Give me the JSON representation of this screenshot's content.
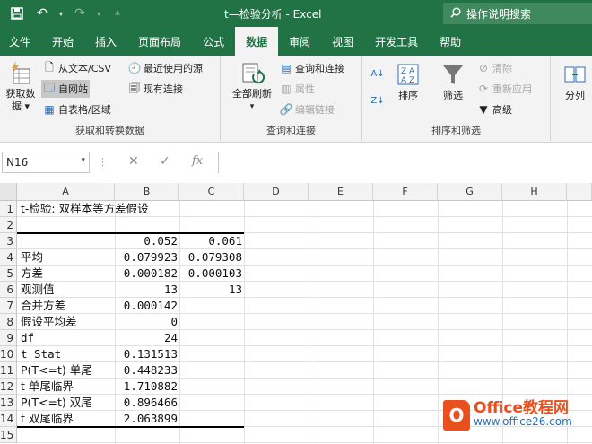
{
  "window": {
    "title": "t—检验分析  -  Excel",
    "tell_me": "操作说明搜索"
  },
  "tabs": [
    {
      "label": "文件"
    },
    {
      "label": "开始"
    },
    {
      "label": "插入"
    },
    {
      "label": "页面布局"
    },
    {
      "label": "公式"
    },
    {
      "label": "数据"
    },
    {
      "label": "审阅"
    },
    {
      "label": "视图"
    },
    {
      "label": "开发工具"
    },
    {
      "label": "帮助"
    }
  ],
  "active_tab": "数据",
  "ribbon": {
    "get_transform": {
      "label": "获取和转换数据",
      "get_data_line1": "获取数",
      "get_data_line2": "据",
      "from_text_csv": "从文本/CSV",
      "from_web": "自网站",
      "from_table": "自表格/区域",
      "recent_sources": "最近使用的源",
      "existing_connections": "现有连接"
    },
    "queries": {
      "label": "查询和连接",
      "refresh_all": "全部刷新",
      "queries_connections": "查询和连接",
      "properties": "属性",
      "edit_links": "编辑链接"
    },
    "sort_filter": {
      "label": "排序和筛选",
      "sort": "排序",
      "filter": "筛选",
      "clear": "清除",
      "reapply": "重新应用",
      "advanced": "高级"
    },
    "data_tools": {
      "split": "分列"
    }
  },
  "formula_bar": {
    "name_box": "N16",
    "fx": "fx",
    "formula": ""
  },
  "columns": [
    "A",
    "B",
    "C",
    "D",
    "E",
    "F",
    "G",
    "H"
  ],
  "rows": [
    "1",
    "2",
    "3",
    "4",
    "5",
    "6",
    "7",
    "8",
    "9",
    "10",
    "11",
    "12",
    "13",
    "14",
    "15"
  ],
  "sheet": {
    "title": "t-检验: 双样本等方差假设",
    "header_b": "0.052",
    "header_c": "0.061",
    "stats": [
      {
        "label": "平均",
        "b": "0.079923",
        "c": "0.079308"
      },
      {
        "label": "方差",
        "b": "0.000182",
        "c": "0.000103"
      },
      {
        "label": "观测值",
        "b": "13",
        "c": "13"
      },
      {
        "label": "合并方差",
        "b": "0.000142",
        "c": ""
      },
      {
        "label": "假设平均差",
        "b": "0",
        "c": ""
      },
      {
        "label": "df",
        "b": "24",
        "c": ""
      },
      {
        "label": "t Stat",
        "b": "0.131513",
        "c": ""
      },
      {
        "label": "P(T<=t) 单尾",
        "b": "0.448233",
        "c": ""
      },
      {
        "label": "t 单尾临界",
        "b": "1.710882",
        "c": ""
      },
      {
        "label": "P(T<=t) 双尾",
        "b": "0.896466",
        "c": ""
      },
      {
        "label": "t 双尾临界",
        "b": "2.063899",
        "c": ""
      }
    ]
  },
  "watermark": {
    "logo": "O",
    "line1": "Office教程网",
    "line2": "www.office26.com"
  }
}
